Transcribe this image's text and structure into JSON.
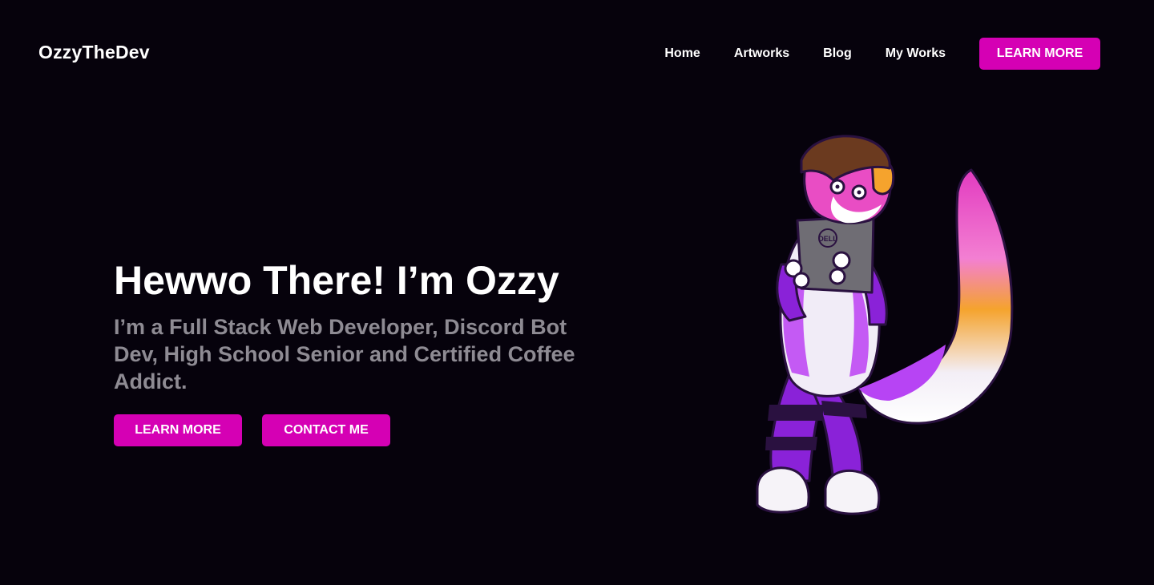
{
  "header": {
    "brand": "OzzyTheDev",
    "nav": [
      "Home",
      "Artworks",
      "Blog",
      "My Works"
    ],
    "cta_label": "LEARN MORE"
  },
  "hero": {
    "title": "Hewwo There! I’m Ozzy",
    "subtitle": "I’m a Full Stack Web Developer, Discord Bot Dev, High School Senior and Certified Coffee Addict.",
    "primary_button": "LEARN MORE",
    "secondary_button": "CONTACT ME"
  },
  "illustration": {
    "subject": "purple-fox-mascot-illustration",
    "laptop_logo": "DELL"
  },
  "colors": {
    "background": "#06020c",
    "accent": "#d500b4",
    "subtitle": "#8e8b93"
  }
}
